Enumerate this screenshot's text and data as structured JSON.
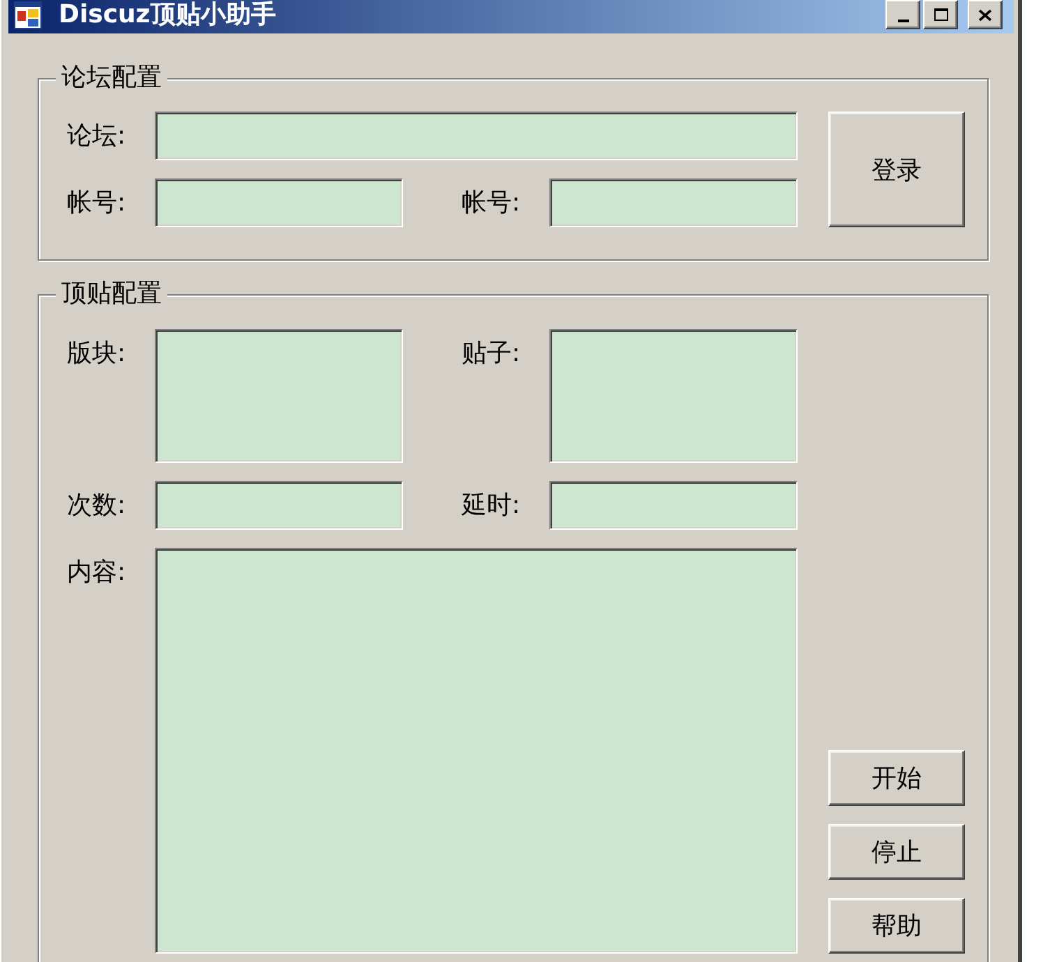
{
  "window": {
    "title": "Discuz顶贴小助手"
  },
  "forum_config": {
    "title": "论坛配置",
    "rows": [
      [
        {
          "label": "论坛:",
          "kind": "line"
        }
      ],
      [
        {
          "label": "帐号:",
          "kind": "line"
        },
        {
          "label": "帐号:",
          "kind": "line"
        }
      ]
    ],
    "buttons": [
      "登录"
    ]
  },
  "post_config": {
    "title": "顶贴配置",
    "rows": [
      [
        {
          "label": "版块:",
          "kind": "box"
        },
        {
          "label": "贴子:",
          "kind": "box"
        }
      ],
      [
        {
          "label": "次数:",
          "kind": "line"
        },
        {
          "label": "延时:",
          "kind": "line"
        }
      ],
      [
        {
          "label": "内容:",
          "kind": "box"
        }
      ]
    ],
    "buttons": [
      "开始",
      "停止",
      "帮助"
    ]
  }
}
